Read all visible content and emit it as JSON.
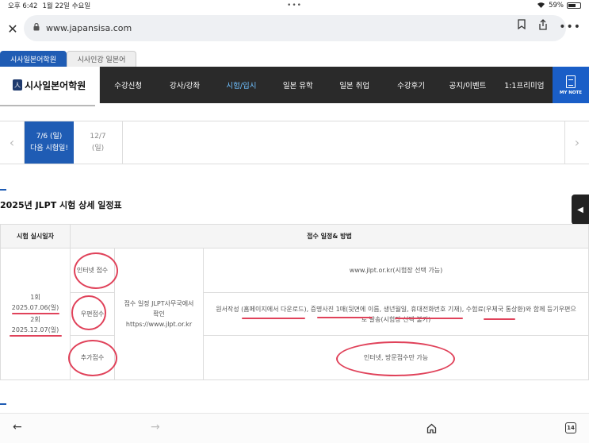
{
  "status_bar": {
    "time": "오후 6:42",
    "date": "1월 22일 수요일",
    "dots": "•••",
    "wifi": "wifi-icon",
    "battery_percent": 59,
    "battery_text": "59%"
  },
  "browser": {
    "close": "✕",
    "url": "www.japansisa.com",
    "bookmark_icon": "bookmark-icon",
    "share_icon": "share-icon",
    "more": "•••",
    "back": "←",
    "forward": "→",
    "home_icon": "home-icon",
    "tab_count": "14"
  },
  "site_tabs": [
    {
      "label": "시사일본어학원",
      "active": true
    },
    {
      "label": "시사인강 일본어",
      "active": false
    }
  ],
  "nav": {
    "logo": "시사일본어학원",
    "items": [
      "수강신청",
      "강사/강좌",
      "시험/입시",
      "일본 유학",
      "일본 취업",
      "수강후기",
      "공지/이벤트",
      "1:1프리미엄"
    ],
    "active_index": 2,
    "my_note": "MY NOTE"
  },
  "date_tabs": [
    {
      "date": "7/6 (일)",
      "sub": "다음 시험일!",
      "active": true
    },
    {
      "date": "12/7",
      "sub": "(일)",
      "active": false
    }
  ],
  "section_title": "2025년 JLPT 시험 상세 일정표",
  "table": {
    "headers": [
      "시험 실시일자",
      "접수 일정& 방법"
    ],
    "exam_dates": [
      "1회",
      "2025.07.06(일)",
      "2회",
      "2025.12.07(일)"
    ],
    "methods": [
      "인터넷 접수",
      "우편접수",
      "추가접수"
    ],
    "schedule_note": "접수 일정 JLPT사무국에서 확인 https://www.jlpt.or.kr",
    "details": [
      "www.jlpt.or.kr(시험장 선택 가능)",
      "원서작성 (홈페이지에서 다운로드), 증명사진 1매(뒷면에 이름, 생년월일, 휴대전화번호 기재), 수험료(우체국 통상환)와 함께 등기우편으로 발송(시험장 선택 불가)",
      "인터넷, 방문접수만 가능"
    ]
  },
  "colors": {
    "brand_blue": "#1f5cb4",
    "nav_bg": "#2a2a2a",
    "annotation_red": "#e0425a",
    "active_menu": "#6fc0ff"
  }
}
